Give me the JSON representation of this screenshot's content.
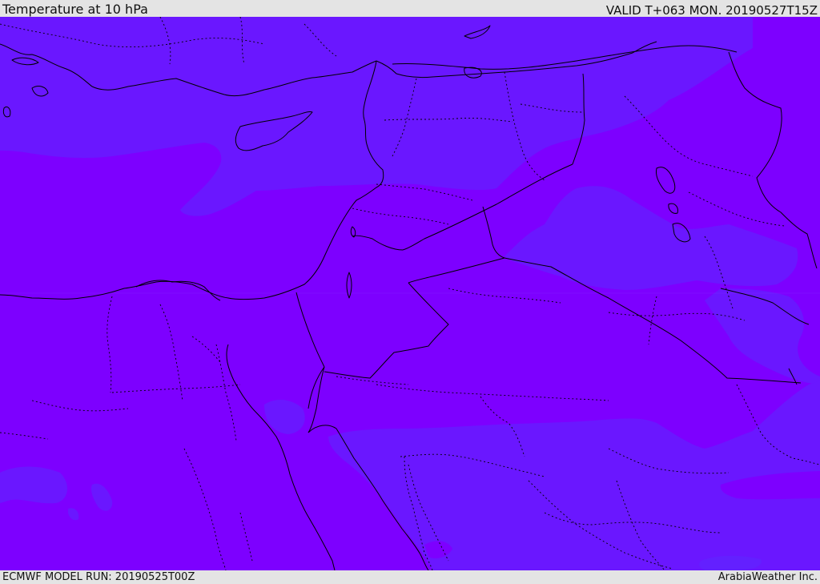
{
  "header": {
    "title": "Temperature at 10 hPa",
    "valid": "VALID T+063 MON. 20190527T15Z"
  },
  "footer": {
    "model_run": "ECMWF MODEL RUN: 20190525T00Z",
    "credit": "ArabiaWeather Inc."
  },
  "map": {
    "variable": "Temperature",
    "level": "10 hPa",
    "colors": {
      "field_warm": "#7d00ff",
      "field_cool": "#6a17ff",
      "field_cooler": "#6320ff",
      "border": "#000000",
      "background": "#e4e4e4"
    }
  }
}
